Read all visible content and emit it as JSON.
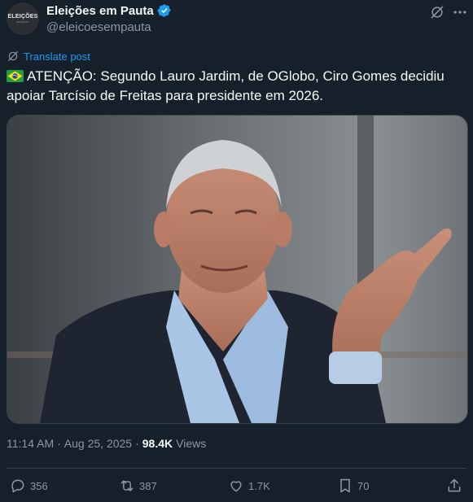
{
  "author": {
    "avatar_text": "ELEIÇÕES",
    "avatar_subtext": "EM PAUTA",
    "display_name": "Eleições em Pauta",
    "handle": "@eleicoesempauta"
  },
  "translate_label": "Translate post",
  "post": {
    "flag": "brazil-flag",
    "text": "ATENÇÃO: Segundo Lauro Jardim, de OGlobo, Ciro Gomes decidiu apoiar Tarcísio de Freitas para presidente em 2026."
  },
  "meta": {
    "time": "11:14 AM",
    "separator": "·",
    "date": "Aug 25, 2025",
    "views_count": "98.4K",
    "views_label": "Views"
  },
  "actions": {
    "replies": "356",
    "reposts": "387",
    "likes": "1.7K",
    "bookmarks": "70"
  },
  "colors": {
    "background": "#15202b",
    "accent": "#1d9bf0",
    "secondary_text": "#8b98a5",
    "border": "#38444d"
  },
  "icons": [
    "verified-badge-icon",
    "grok-icon",
    "more-icon",
    "translate-icon",
    "reply-icon",
    "repost-icon",
    "like-icon",
    "bookmark-icon",
    "share-icon"
  ]
}
